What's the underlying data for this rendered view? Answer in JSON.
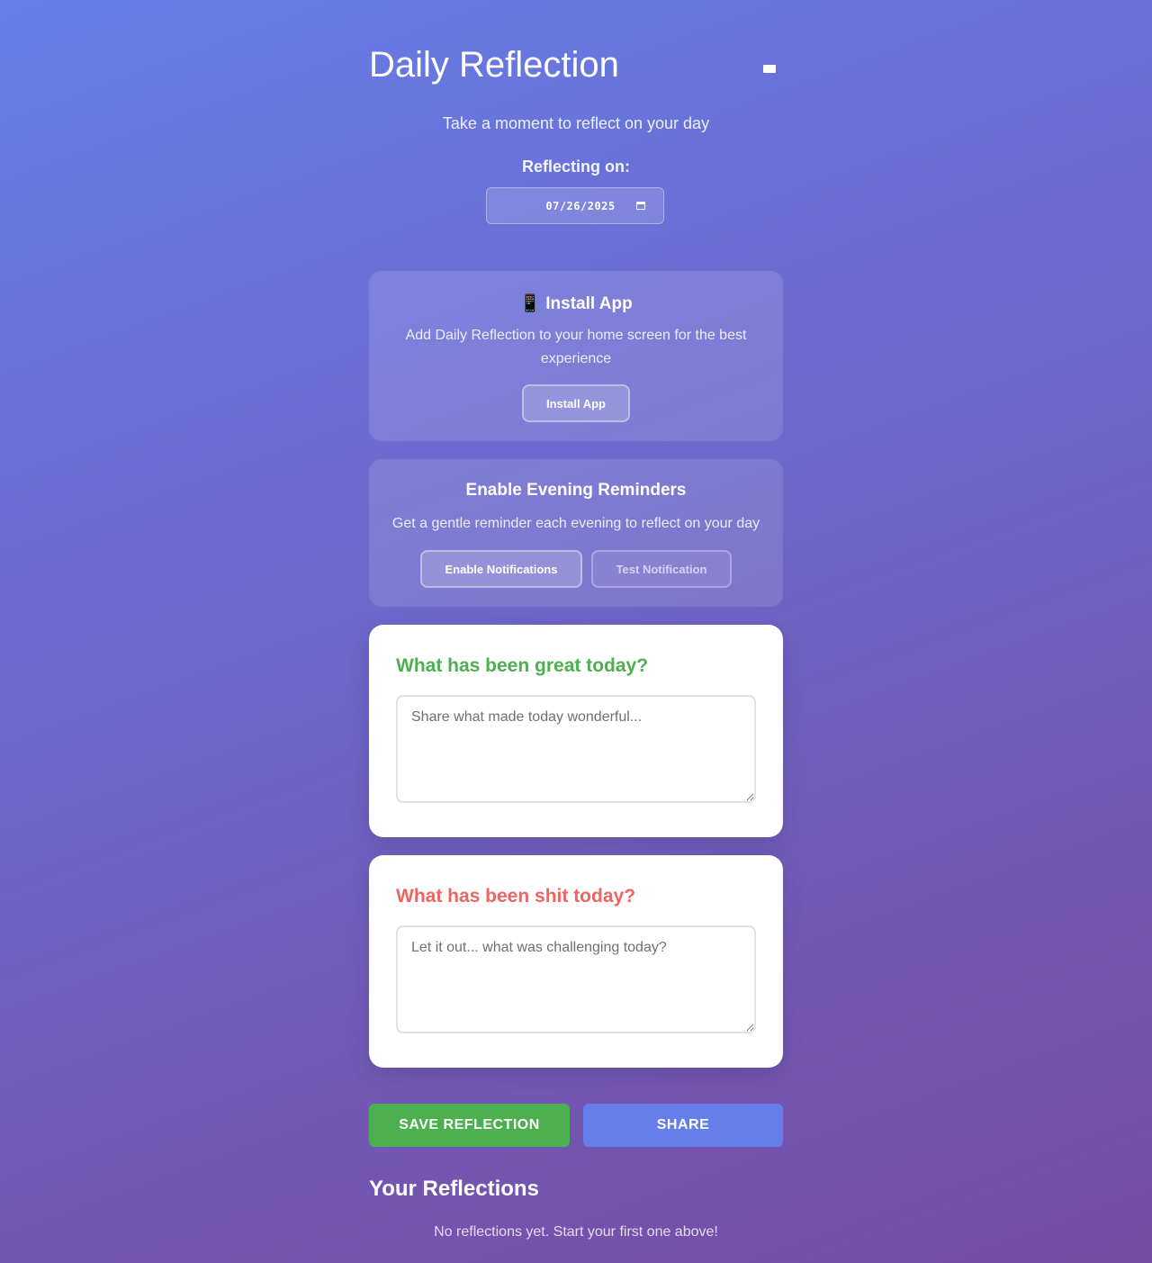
{
  "header": {
    "title": "Daily Reflection",
    "menu_icon": "minimize-icon",
    "subtitle": "Take a moment to reflect on your day"
  },
  "date_picker": {
    "label": "Reflecting on:",
    "value": "07/26/2025",
    "icon": "calendar-icon"
  },
  "install_card": {
    "icon": "📱",
    "title": "Install App",
    "description": "Add Daily Reflection to your home screen for the best experience",
    "button_label": "Install App"
  },
  "reminder_card": {
    "title": "Enable Evening Reminders",
    "description": "Get a gentle reminder each evening to reflect on your day",
    "enable_button_label": "Enable Notifications",
    "test_button_label": "Test Notification"
  },
  "great_card": {
    "question": "What has been great today?",
    "placeholder": "Share what made today wonderful...",
    "value": "",
    "color": "#4caf50"
  },
  "shit_card": {
    "question": "What has been shit today?",
    "placeholder": "Let it out... what was challenging today?",
    "value": "",
    "color": "#ef6461"
  },
  "actions": {
    "save_label": "SAVE REFLECTION",
    "share_label": "SHARE",
    "save_color": "#4caf50",
    "share_color": "#667eea"
  },
  "reflections": {
    "title": "Your Reflections",
    "empty_message": "No reflections yet. Start your first one above!"
  }
}
